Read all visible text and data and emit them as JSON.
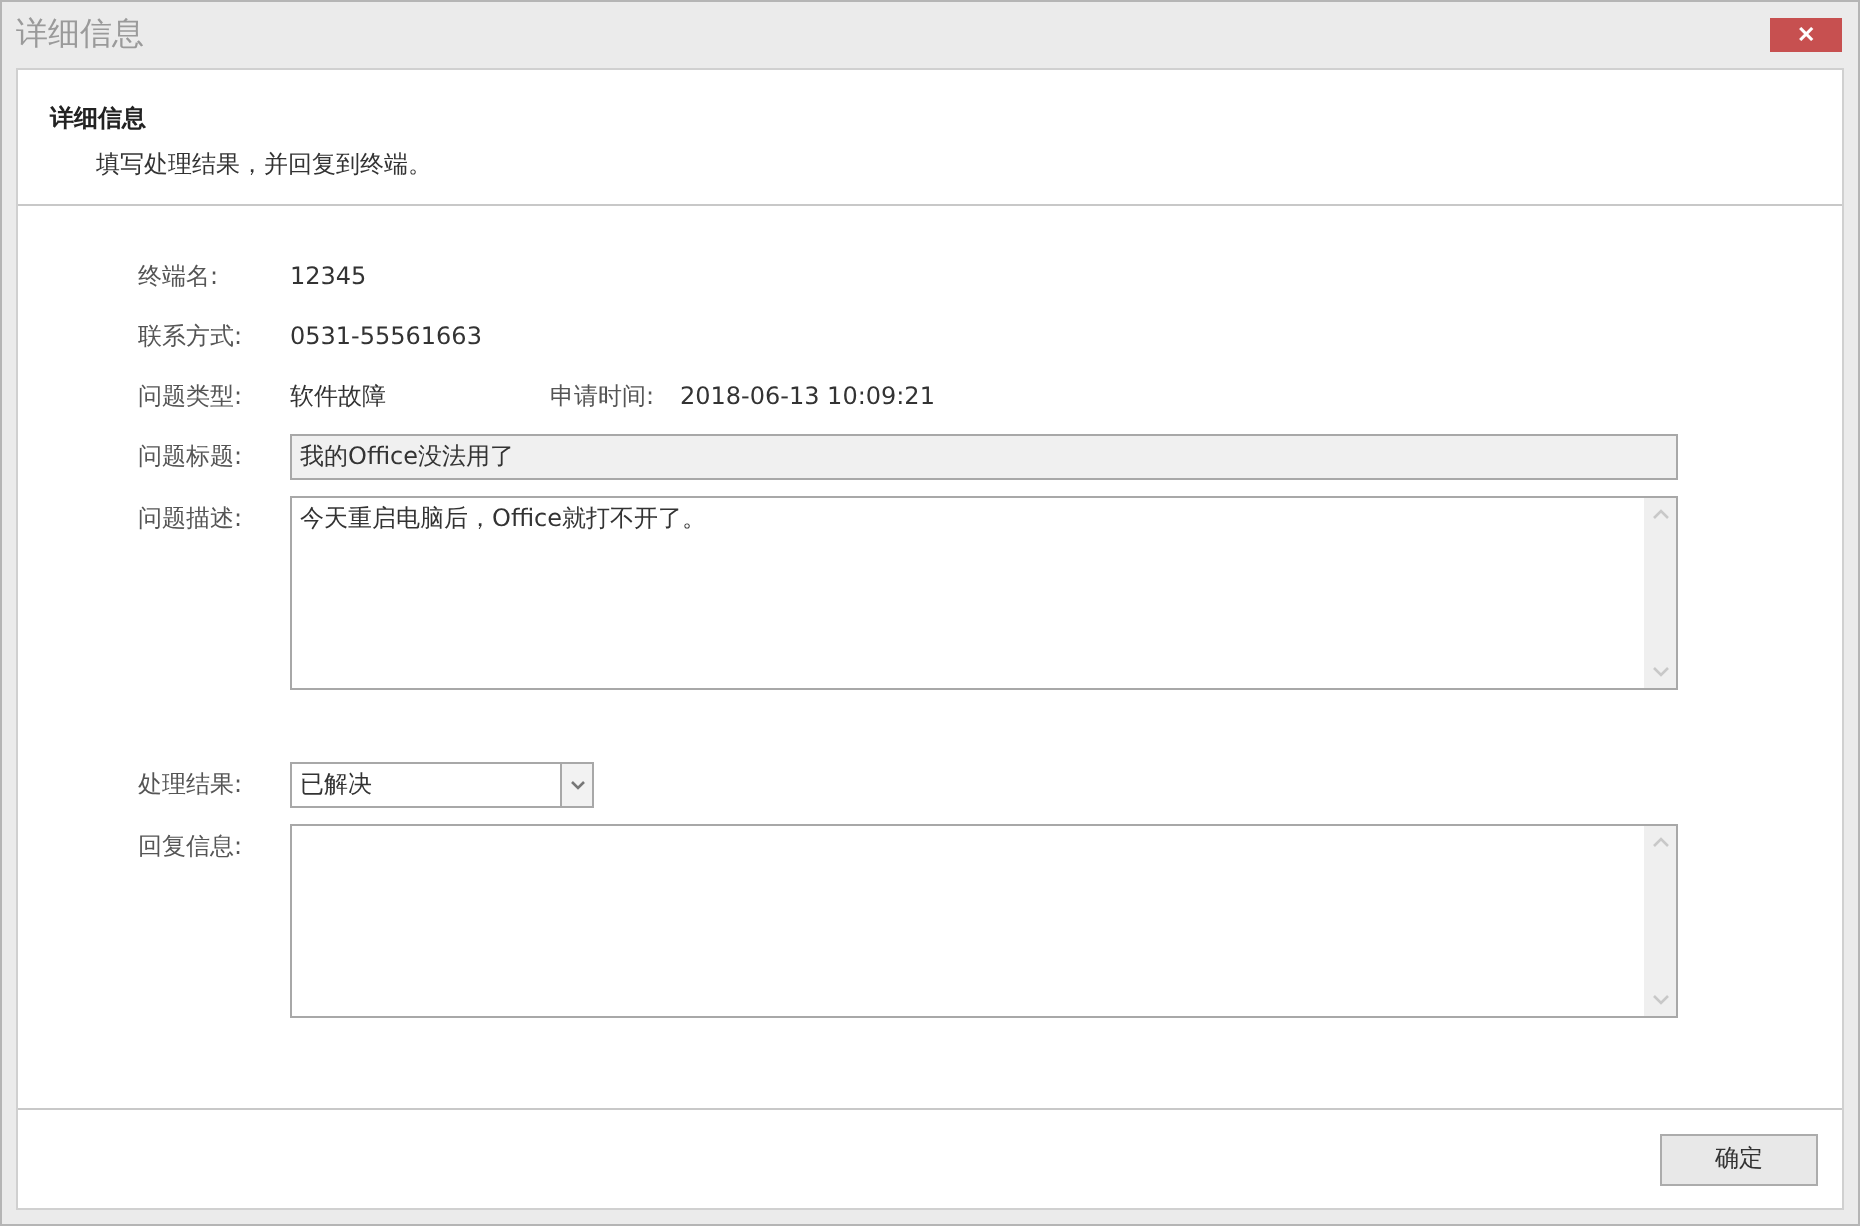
{
  "window": {
    "title": "详细信息",
    "close_glyph": "✕"
  },
  "header": {
    "title": "详细信息",
    "subtitle": "填写处理结果，并回复到终端。"
  },
  "info_rows": [
    {
      "label": "终端名:",
      "value": "12345"
    },
    {
      "label": "联系方式:",
      "value": "0531-55561663"
    },
    {
      "label": "问题类型:",
      "value": "软件故障",
      "extra_label": "申请时间:",
      "extra_value": "2018-06-13 10:09:21"
    }
  ],
  "issue_title": {
    "label": "问题标题:",
    "value": "我的Office没法用了",
    "disabled": true
  },
  "issue_description": {
    "label": "问题描述:",
    "value": "今天重启电脑后，Office就打不开了。"
  },
  "result": {
    "label": "处理结果:",
    "value": "已解决"
  },
  "reply": {
    "label": "回复信息:"
  },
  "buttons": [
    "确定"
  ]
}
